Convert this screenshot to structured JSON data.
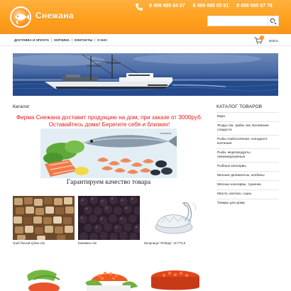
{
  "header": {
    "brand": "Снежана",
    "phones": [
      "8 499 995 04 07",
      "8 499 995 05 91",
      "8 499 995 07 76"
    ],
    "search_placeholder": "",
    "accent_color": "#ff9f1a"
  },
  "nav": {
    "items": [
      "ДОСТАВКА И ОПЛАТА",
      "КОРЗИНА",
      "КОНТАКТЫ",
      "О НАС"
    ],
    "cart_count": "0",
    "login": "Войти"
  },
  "main": {
    "title": "Каталог",
    "promo_line1": "Фирма Снежана доставит продукцию на дом, при заказе от 3000руб.",
    "promo_line2": "Оставайтесь дома! Берегите себя и близких!",
    "banner_label": "снежана",
    "guarantee": "Гарантируем качество товара",
    "products": [
      {
        "name": "Гриб белый кубик с/м"
      },
      {
        "name": "Ежевика с/м"
      },
      {
        "name": "Икорница \"Лебедь\" 11*7*8,5"
      }
    ]
  },
  "sidebar": {
    "title": "КАТАЛОГ ТОВАРОВ",
    "items": [
      "Икра",
      "Ягоды с/м, грибы с/м, Белевские сладости",
      "Рыба слабосоленая, холодного копчения",
      "Рыба, морепродукты свежемороженые",
      "Рыбные консервы",
      "Мясные деликатесы, колбасы",
      "Мясные консервы, тушенка",
      "Масло, молоко, сыры",
      "Товары для дома"
    ]
  }
}
